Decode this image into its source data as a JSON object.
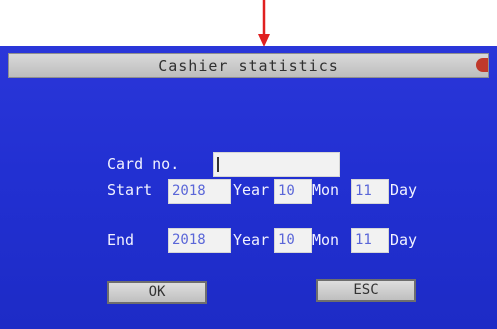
{
  "window": {
    "title": "Cashier statistics"
  },
  "form": {
    "card_label": "Card no.",
    "card_value": "",
    "start_label": "Start",
    "end_label": "End",
    "year_label": "Year",
    "mon_label": "Mon",
    "day_label": "Day",
    "start": {
      "year": "2018",
      "mon": "10",
      "day": "11"
    },
    "end": {
      "year": "2018",
      "mon": "10",
      "day": "11"
    }
  },
  "buttons": {
    "ok": "OK",
    "esc": "ESC"
  },
  "colors": {
    "screen_bg": "#2230d2",
    "annotation_arrow": "#e02020"
  },
  "icons": {
    "annotation": "red-down-arrow",
    "close": "close-icon"
  }
}
